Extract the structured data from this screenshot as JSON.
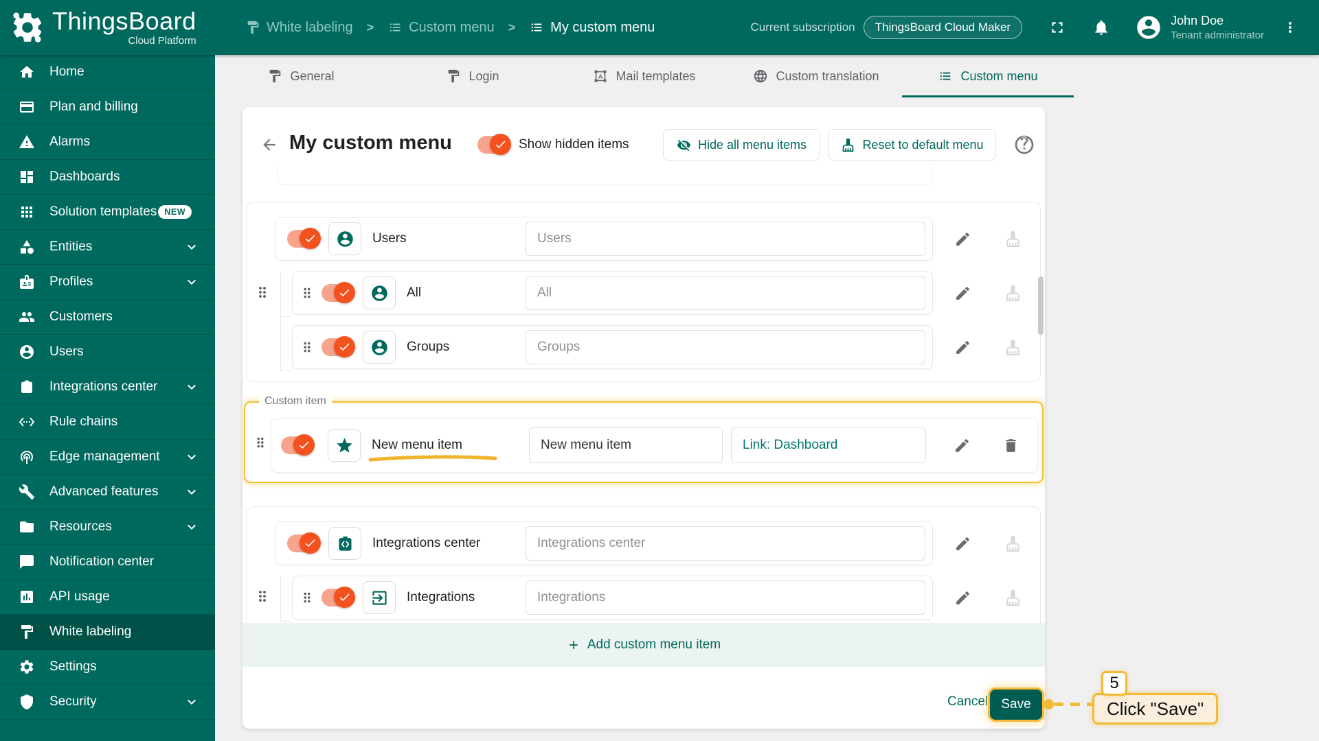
{
  "app": {
    "logo_title": "ThingsBoard",
    "logo_subtitle": "Cloud Platform"
  },
  "header": {
    "breadcrumbs": [
      {
        "label": "White labeling",
        "icon": "paint"
      },
      {
        "label": "Custom menu",
        "icon": "list"
      },
      {
        "label": "My custom menu",
        "icon": "list"
      }
    ],
    "subscription": {
      "label": "Current subscription",
      "value": "ThingsBoard Cloud Maker"
    },
    "user": {
      "name": "John Doe",
      "role": "Tenant administrator"
    }
  },
  "sidebar": {
    "items": [
      {
        "label": "Home",
        "icon": "home"
      },
      {
        "label": "Plan and billing",
        "icon": "card"
      },
      {
        "label": "Alarms",
        "icon": "warn"
      },
      {
        "label": "Dashboards",
        "icon": "dash"
      },
      {
        "label": "Solution templates",
        "icon": "apps",
        "badge": "NEW"
      },
      {
        "label": "Entities",
        "icon": "category",
        "expandable": true
      },
      {
        "label": "Profiles",
        "icon": "badge",
        "expandable": true
      },
      {
        "label": "Customers",
        "icon": "people"
      },
      {
        "label": "Users",
        "icon": "person"
      },
      {
        "label": "Integrations center",
        "icon": "integration",
        "expandable": true
      },
      {
        "label": "Rule chains",
        "icon": "ethernet"
      },
      {
        "label": "Edge management",
        "icon": "antenna",
        "expandable": true
      },
      {
        "label": "Advanced features",
        "icon": "build",
        "expandable": true
      },
      {
        "label": "Resources",
        "icon": "folder",
        "expandable": true
      },
      {
        "label": "Notification center",
        "icon": "chat"
      },
      {
        "label": "API usage",
        "icon": "chart",
        "expandable": false
      },
      {
        "label": "White labeling",
        "icon": "paint",
        "active": true
      },
      {
        "label": "Settings",
        "icon": "gear"
      },
      {
        "label": "Security",
        "icon": "shield",
        "expandable": true
      }
    ]
  },
  "tabs": [
    {
      "label": "General",
      "icon": "paint"
    },
    {
      "label": "Login",
      "icon": "paint"
    },
    {
      "label": "Mail templates",
      "icon": "mailframe"
    },
    {
      "label": "Custom translation",
      "icon": "globe"
    },
    {
      "label": "Custom menu",
      "icon": "list",
      "active": true
    }
  ],
  "panel": {
    "title": "My custom menu",
    "show_hidden_label": "Show hidden items",
    "hide_all_button": "Hide all menu items",
    "reset_button": "Reset to default menu"
  },
  "menu": {
    "groups": [
      {
        "rows": [
          {
            "label": "Users",
            "value": "Users",
            "icon": "person"
          },
          {
            "label": "All",
            "value": "All",
            "icon": "person"
          },
          {
            "label": "Groups",
            "value": "Groups",
            "icon": "person"
          }
        ]
      },
      {
        "legend": "Custom item",
        "row": {
          "label": "New menu item",
          "value": "New menu item",
          "link": "Link: Dashboard",
          "icon": "star"
        }
      },
      {
        "rows": [
          {
            "label": "Integrations center",
            "value": "Integrations center",
            "icon": "integration"
          },
          {
            "label": "Integrations",
            "value": "Integrations",
            "icon": "exit"
          }
        ]
      }
    ],
    "add_button": "Add custom menu item"
  },
  "footer": {
    "cancel": "Cancel",
    "save": "Save"
  },
  "annotation": {
    "step": "5",
    "text": "Click \"Save\""
  },
  "colors": {
    "primary": "#00695c",
    "toggle_thumb": "#f4511e",
    "toggle_track": "#f8a38c",
    "highlight": "#f3ba34",
    "link_text": "#00796b"
  }
}
